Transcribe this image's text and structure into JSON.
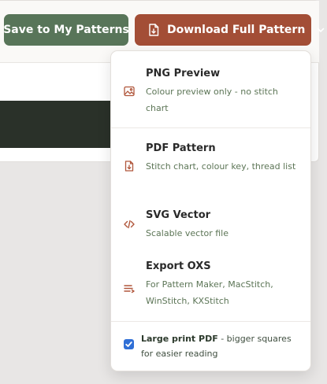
{
  "toolbar": {
    "save_label": "Save to My Patterns",
    "download_label": "Download Full Pattern"
  },
  "menu": {
    "items": [
      {
        "title": "PNG Preview",
        "description": "Colour preview only - no stitch chart",
        "icon": "image-icon"
      },
      {
        "title": "PDF Pattern",
        "description": "Stitch chart, colour key, thread list",
        "icon": "pdf-file-icon"
      },
      {
        "title": "SVG Vector",
        "description": "Scalable vector file",
        "icon": "code-icon"
      },
      {
        "title": "Export OXS",
        "description": "For Pattern Maker, MacStitch, WinStitch, KXStitch",
        "icon": "export-lines-icon"
      }
    ],
    "large_print": {
      "checked": true,
      "label_bold": "Large print PDF",
      "label_rest": " - bigger squares for easier reading"
    }
  },
  "colors": {
    "save_button": "#587559",
    "download_button": "#a34e36",
    "accent_icon": "#b0563b",
    "description_text": "#5c7556",
    "checkbox": "#2f6fd6"
  }
}
